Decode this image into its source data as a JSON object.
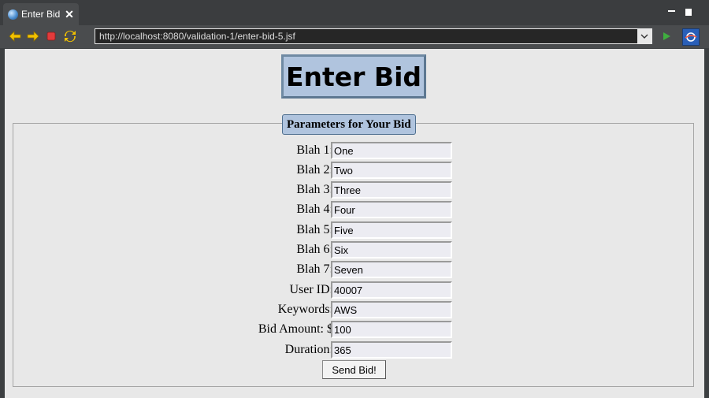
{
  "tab": {
    "title": "Enter Bid",
    "close": "✕"
  },
  "toolbar": {
    "url": "http://localhost:8080/validation-1/enter-bid-5.jsf"
  },
  "page": {
    "heading": "Enter Bid",
    "legend": "Parameters for Your Bid",
    "fields": [
      {
        "label": "Blah 1:",
        "value": "One"
      },
      {
        "label": "Blah 2:",
        "value": "Two"
      },
      {
        "label": "Blah 3:",
        "value": "Three"
      },
      {
        "label": "Blah 4:",
        "value": "Four"
      },
      {
        "label": "Blah 5:",
        "value": "Five"
      },
      {
        "label": "Blah 6:",
        "value": "Six"
      },
      {
        "label": "Blah 7:",
        "value": "Seven"
      },
      {
        "label": "User ID:",
        "value": "40007"
      },
      {
        "label": "Keywords:",
        "value": "AWS"
      },
      {
        "label": "Bid Amount: $",
        "value": "100"
      },
      {
        "label": "Duration:",
        "value": "365"
      }
    ],
    "submit_label": "Send Bid!"
  },
  "colors": {
    "heading_bg": "#b0c4de",
    "content_bg": "#e8e8e8",
    "chrome_bg": "#4a4c4e"
  },
  "icons": [
    "globe-icon",
    "close-icon",
    "back-icon",
    "forward-icon",
    "stop-icon",
    "refresh-icon",
    "chevron-down-icon",
    "go-icon",
    "browser-logo-icon"
  ]
}
